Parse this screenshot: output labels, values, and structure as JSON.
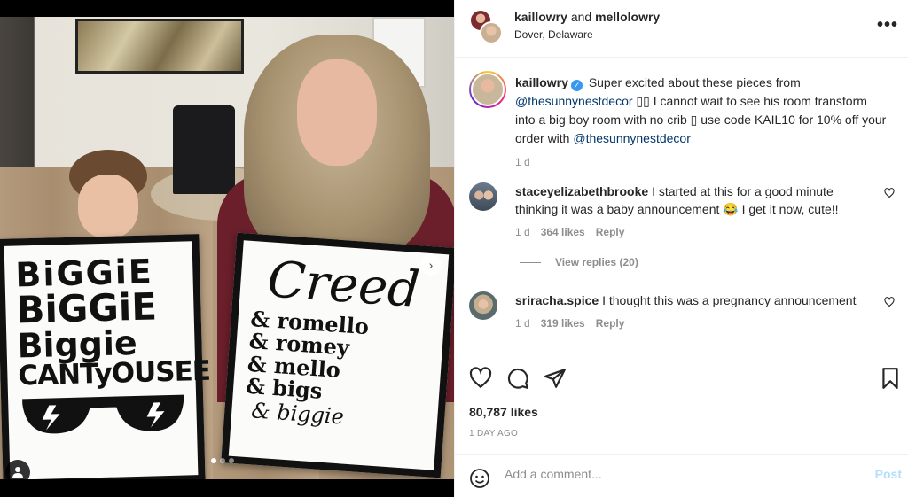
{
  "header": {
    "user1": "kaillowry",
    "and_text": "and",
    "user2": "mellolowry",
    "location": "Dover, Delaware",
    "more_label": "•••"
  },
  "photo": {
    "sign_left": [
      "BiGGiE",
      "BiGGiE",
      "Biggie",
      "CANTyOUSEE"
    ],
    "sign_right_title": "Creed",
    "sign_right_lines": [
      "& romello",
      "& romey",
      "& mello",
      "& bigs"
    ],
    "sign_right_last": "& biggie",
    "next_label": "›",
    "dots_total": 3,
    "dots_active": 1
  },
  "caption": {
    "username": "kaillowry",
    "text_1": "Super excited about these pieces from",
    "mention_1": "@thesunnynestdecor",
    "text_2": "▯▯ I cannot wait to see his room transform into a big boy room with no crib ▯ use code KAIL10 for 10% off your order with",
    "mention_2": "@thesunnynestdecor",
    "time": "1 d"
  },
  "comments": [
    {
      "username": "staceyelizabethbrooke",
      "text": "I started at this for a good minute thinking it was a baby announcement 😂 I get it now, cute!!",
      "time": "1 d",
      "likes": "364 likes",
      "reply": "Reply"
    },
    {
      "username": "sriracha.spice",
      "text": "I thought this was a pregnancy announcement",
      "time": "1 d",
      "likes": "319 likes",
      "reply": "Reply"
    }
  ],
  "view_replies": "View replies (20)",
  "actions": {
    "likes": "80,787 likes",
    "date": "1 DAY AGO"
  },
  "add_comment": {
    "placeholder": "Add a comment...",
    "post_label": "Post"
  },
  "colors": {
    "link": "#00376b",
    "verified": "#3897f0",
    "post_disabled": "#b2dffc",
    "secondary_text": "#8e8e8e"
  }
}
